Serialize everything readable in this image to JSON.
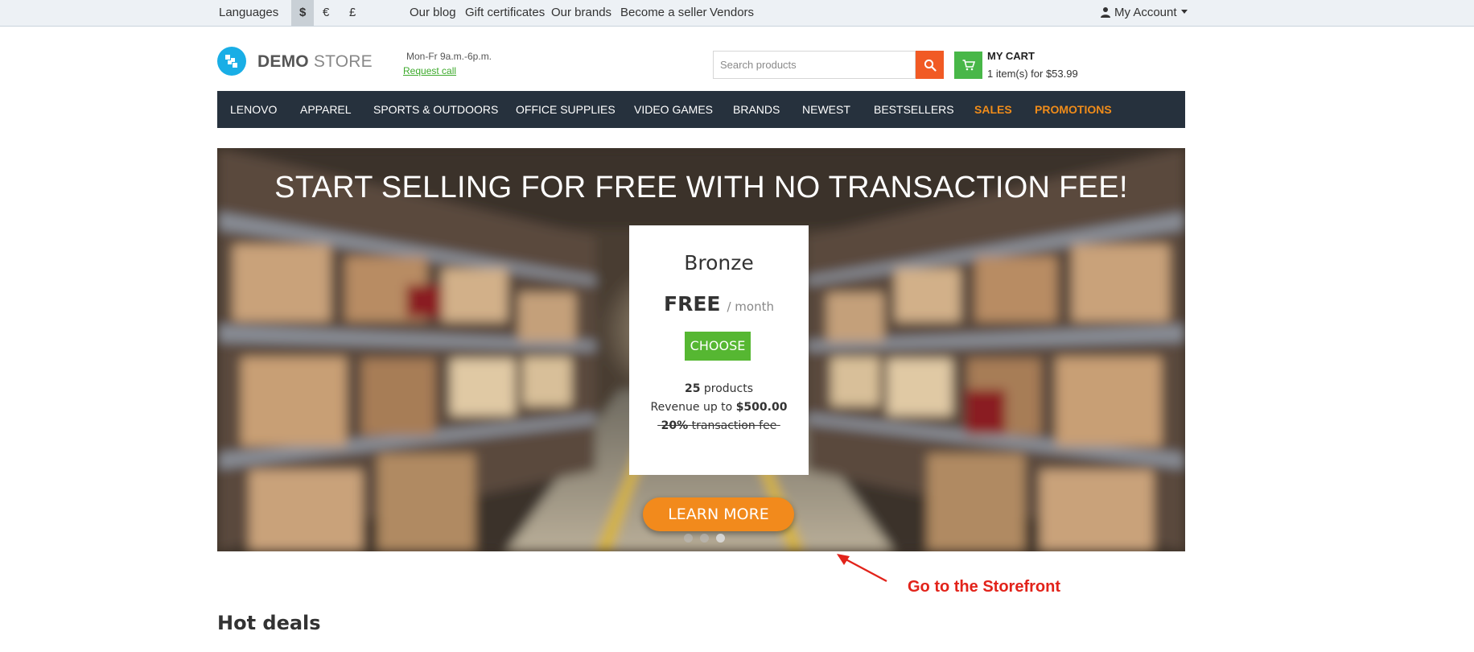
{
  "topbar": {
    "languages": "Languages",
    "currencies": [
      "$",
      "€",
      "£"
    ],
    "links": [
      "Our blog",
      "Gift certificates",
      "Our brands",
      "Become a seller",
      "Vendors"
    ],
    "account": "My Account"
  },
  "header": {
    "logo_bold": "DEMO",
    "logo_light": "STORE",
    "hours": "Mon-Fr 9a.m.-6p.m.",
    "request_call": "Request call",
    "search_placeholder": "Search products",
    "cart_title": "MY CART",
    "cart_summary": "1 item(s) for $53.99"
  },
  "nav": {
    "items": [
      "LENOVO",
      "APPAREL",
      "SPORTS & OUTDOORS",
      "OFFICE SUPPLIES",
      "VIDEO GAMES",
      "BRANDS",
      "NEWEST",
      "BESTSELLERS",
      "SALES",
      "PROMOTIONS"
    ]
  },
  "hero": {
    "title": "START SELLING FOR FREE WITH NO TRANSACTION FEE!",
    "plan_name": "Bronze",
    "plan_price": "FREE",
    "plan_period": "/ month",
    "choose": "CHOOSE",
    "products_count": "25",
    "products_label": "products",
    "revenue_label": "Revenue up to",
    "revenue_value": "$500.00",
    "fee_value": "20%",
    "fee_label": "transaction fee",
    "learn_more": "LEARN MORE"
  },
  "annotation": "Go to the Storefront",
  "section_title": "Hot deals",
  "colors": {
    "nav_bg": "#26313d",
    "accent_orange": "#f28a1c",
    "search_button": "#f15a24",
    "cart_button": "#48b748",
    "choose_button": "#56b732",
    "annotation_red": "#e2231a"
  }
}
